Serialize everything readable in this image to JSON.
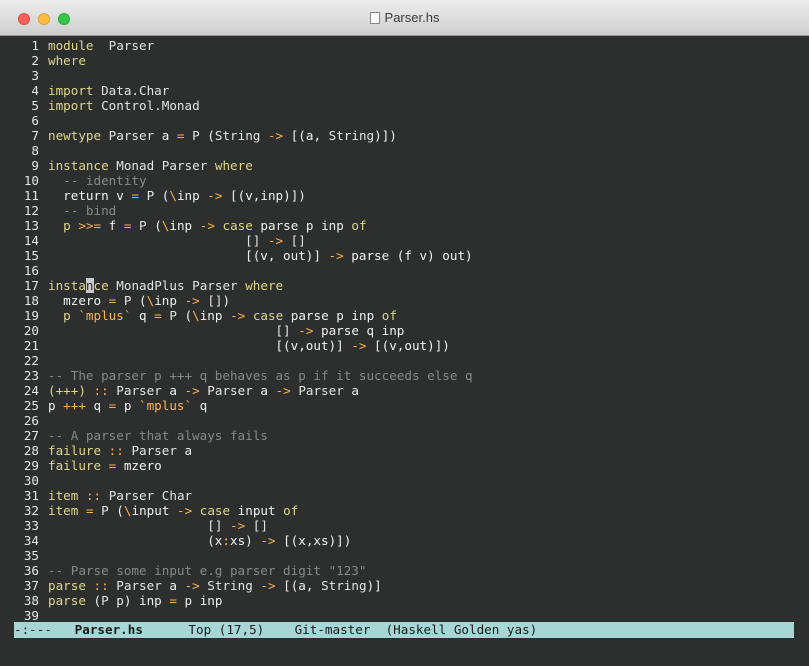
{
  "window": {
    "title": "Parser.hs"
  },
  "modeline": {
    "status": "-:---",
    "buffer": "Parser.hs",
    "position": "Top (17,5)",
    "vcs": "Git-master",
    "modes": "(Haskell Golden yas)"
  },
  "lines": [
    {
      "n": "1",
      "seg": [
        [
          "kw",
          "module"
        ],
        [
          "",
          "  "
        ],
        [
          "ty",
          "Parser"
        ]
      ]
    },
    {
      "n": "2",
      "seg": [
        [
          "kw",
          "where"
        ]
      ]
    },
    {
      "n": "3",
      "seg": []
    },
    {
      "n": "4",
      "seg": [
        [
          "kw",
          "import"
        ],
        [
          "",
          " "
        ],
        [
          "ty",
          "Data.Char"
        ]
      ]
    },
    {
      "n": "5",
      "seg": [
        [
          "kw",
          "import"
        ],
        [
          "",
          " "
        ],
        [
          "ty",
          "Control.Monad"
        ]
      ]
    },
    {
      "n": "6",
      "seg": []
    },
    {
      "n": "7",
      "seg": [
        [
          "kw",
          "newtype"
        ],
        [
          "",
          " "
        ],
        [
          "ty",
          "Parser"
        ],
        [
          "",
          " a "
        ],
        [
          "op",
          "="
        ],
        [
          "",
          " "
        ],
        [
          "ty",
          "P"
        ],
        [
          "",
          " ("
        ],
        [
          "ty",
          "String"
        ],
        [
          "",
          " "
        ],
        [
          "op",
          "->"
        ],
        [
          "",
          " [(a, "
        ],
        [
          "ty",
          "String"
        ],
        [
          "",
          ")])"
        ]
      ]
    },
    {
      "n": "8",
      "seg": []
    },
    {
      "n": "9",
      "seg": [
        [
          "kw",
          "instance"
        ],
        [
          "",
          " "
        ],
        [
          "ty",
          "Monad"
        ],
        [
          "",
          " "
        ],
        [
          "ty",
          "Parser"
        ],
        [
          "",
          " "
        ],
        [
          "kw",
          "where"
        ]
      ]
    },
    {
      "n": "10",
      "seg": [
        [
          "",
          "  "
        ],
        [
          "cm",
          "-- identity"
        ]
      ]
    },
    {
      "n": "11",
      "seg": [
        [
          "",
          "  return v "
        ],
        [
          "op",
          "="
        ],
        [
          "",
          " "
        ],
        [
          "ty",
          "P"
        ],
        [
          "",
          " ("
        ],
        [
          "op",
          "\\"
        ],
        [
          "",
          "inp "
        ],
        [
          "op",
          "->"
        ],
        [
          "",
          " [(v,inp)])"
        ]
      ]
    },
    {
      "n": "12",
      "seg": [
        [
          "",
          "  "
        ],
        [
          "cm",
          "-- bind"
        ]
      ]
    },
    {
      "n": "13",
      "seg": [
        [
          "kw",
          "  p"
        ],
        [
          "",
          " "
        ],
        [
          "op",
          ">>="
        ],
        [
          "",
          " f "
        ],
        [
          "op",
          "="
        ],
        [
          "",
          " "
        ],
        [
          "ty",
          "P"
        ],
        [
          "",
          " ("
        ],
        [
          "op",
          "\\"
        ],
        [
          "",
          "inp "
        ],
        [
          "op",
          "->"
        ],
        [
          "",
          " "
        ],
        [
          "kw",
          "case"
        ],
        [
          "",
          " parse p inp "
        ],
        [
          "kw",
          "of"
        ]
      ]
    },
    {
      "n": "14",
      "seg": [
        [
          "",
          "                          "
        ],
        [
          "ty",
          "[]"
        ],
        [
          "",
          " "
        ],
        [
          "op",
          "->"
        ],
        [
          "",
          " "
        ],
        [
          "ty",
          "[]"
        ]
      ]
    },
    {
      "n": "15",
      "seg": [
        [
          "",
          "                          [(v, out)] "
        ],
        [
          "op",
          "->"
        ],
        [
          "",
          " parse (f v) out)"
        ]
      ]
    },
    {
      "n": "16",
      "seg": []
    },
    {
      "n": "17",
      "seg": [
        [
          "kw",
          "insta"
        ],
        [
          "cursor",
          "n"
        ],
        [
          "kw",
          "ce"
        ],
        [
          "",
          " "
        ],
        [
          "ty",
          "MonadPlus"
        ],
        [
          "",
          " "
        ],
        [
          "ty",
          "Parser"
        ],
        [
          "",
          " "
        ],
        [
          "kw",
          "where"
        ]
      ]
    },
    {
      "n": "18",
      "seg": [
        [
          "",
          "  mzero "
        ],
        [
          "op",
          "="
        ],
        [
          "",
          " "
        ],
        [
          "ty",
          "P"
        ],
        [
          "",
          " ("
        ],
        [
          "op",
          "\\"
        ],
        [
          "",
          "inp "
        ],
        [
          "op",
          "->"
        ],
        [
          "",
          " "
        ],
        [
          "ty",
          "[]"
        ],
        [
          "",
          ")"
        ]
      ]
    },
    {
      "n": "19",
      "seg": [
        [
          "kw",
          "  p"
        ],
        [
          "",
          " "
        ],
        [
          "op",
          "`mplus`"
        ],
        [
          "",
          " q "
        ],
        [
          "op",
          "="
        ],
        [
          "",
          " "
        ],
        [
          "ty",
          "P"
        ],
        [
          "",
          " ("
        ],
        [
          "op",
          "\\"
        ],
        [
          "",
          "inp "
        ],
        [
          "op",
          "->"
        ],
        [
          "",
          " "
        ],
        [
          "kw",
          "case"
        ],
        [
          "",
          " parse p inp "
        ],
        [
          "kw",
          "of"
        ]
      ]
    },
    {
      "n": "20",
      "seg": [
        [
          "",
          "                              "
        ],
        [
          "ty",
          "[]"
        ],
        [
          "",
          " "
        ],
        [
          "op",
          "->"
        ],
        [
          "",
          " parse q inp"
        ]
      ]
    },
    {
      "n": "21",
      "seg": [
        [
          "",
          "                              [(v,out)] "
        ],
        [
          "op",
          "->"
        ],
        [
          "",
          " [(v,out)])"
        ]
      ]
    },
    {
      "n": "22",
      "seg": []
    },
    {
      "n": "23",
      "seg": [
        [
          "cm",
          "-- The parser p +++ q behaves as p if it succeeds else q"
        ]
      ]
    },
    {
      "n": "24",
      "seg": [
        [
          "kw",
          "(+++)"
        ],
        [
          "",
          " "
        ],
        [
          "op",
          "::"
        ],
        [
          "",
          " "
        ],
        [
          "ty",
          "Parser"
        ],
        [
          "",
          " a "
        ],
        [
          "op",
          "->"
        ],
        [
          "",
          " "
        ],
        [
          "ty",
          "Parser"
        ],
        [
          "",
          " a "
        ],
        [
          "op",
          "->"
        ],
        [
          "",
          " "
        ],
        [
          "ty",
          "Parser"
        ],
        [
          "",
          " a"
        ]
      ]
    },
    {
      "n": "25",
      "seg": [
        [
          "",
          "p "
        ],
        [
          "op",
          "+++"
        ],
        [
          "",
          " q "
        ],
        [
          "op",
          "="
        ],
        [
          "",
          " p "
        ],
        [
          "op",
          "`mplus`"
        ],
        [
          "",
          " q"
        ]
      ]
    },
    {
      "n": "26",
      "seg": []
    },
    {
      "n": "27",
      "seg": [
        [
          "cm",
          "-- A parser that always fails"
        ]
      ]
    },
    {
      "n": "28",
      "seg": [
        [
          "kw",
          "failure"
        ],
        [
          "",
          " "
        ],
        [
          "op",
          "::"
        ],
        [
          "",
          " "
        ],
        [
          "ty",
          "Parser"
        ],
        [
          "",
          " a"
        ]
      ]
    },
    {
      "n": "29",
      "seg": [
        [
          "kw",
          "failure"
        ],
        [
          "",
          " "
        ],
        [
          "op",
          "="
        ],
        [
          "",
          " mzero"
        ]
      ]
    },
    {
      "n": "30",
      "seg": []
    },
    {
      "n": "31",
      "seg": [
        [
          "kw",
          "item"
        ],
        [
          "",
          " "
        ],
        [
          "op",
          "::"
        ],
        [
          "",
          " "
        ],
        [
          "ty",
          "Parser"
        ],
        [
          "",
          " "
        ],
        [
          "ty",
          "Char"
        ]
      ]
    },
    {
      "n": "32",
      "seg": [
        [
          "kw",
          "item"
        ],
        [
          "",
          " "
        ],
        [
          "op",
          "="
        ],
        [
          "",
          " "
        ],
        [
          "ty",
          "P"
        ],
        [
          "",
          " ("
        ],
        [
          "op",
          "\\"
        ],
        [
          "",
          "input "
        ],
        [
          "op",
          "->"
        ],
        [
          "",
          " "
        ],
        [
          "kw",
          "case"
        ],
        [
          "",
          " input "
        ],
        [
          "kw",
          "of"
        ]
      ]
    },
    {
      "n": "33",
      "seg": [
        [
          "",
          "                     "
        ],
        [
          "ty",
          "[]"
        ],
        [
          "",
          " "
        ],
        [
          "op",
          "->"
        ],
        [
          "",
          " "
        ],
        [
          "ty",
          "[]"
        ]
      ]
    },
    {
      "n": "34",
      "seg": [
        [
          "",
          "                     (x"
        ],
        [
          "op",
          ":"
        ],
        [
          "",
          "xs) "
        ],
        [
          "op",
          "->"
        ],
        [
          "",
          " [(x,xs)])"
        ]
      ]
    },
    {
      "n": "35",
      "seg": []
    },
    {
      "n": "36",
      "seg": [
        [
          "cm",
          "-- Parse some input e.g parser digit \"123\""
        ]
      ]
    },
    {
      "n": "37",
      "seg": [
        [
          "kw",
          "parse"
        ],
        [
          "",
          " "
        ],
        [
          "op",
          "::"
        ],
        [
          "",
          " "
        ],
        [
          "ty",
          "Parser"
        ],
        [
          "",
          " a "
        ],
        [
          "op",
          "->"
        ],
        [
          "",
          " "
        ],
        [
          "ty",
          "String"
        ],
        [
          "",
          " "
        ],
        [
          "op",
          "->"
        ],
        [
          "",
          " [(a, "
        ],
        [
          "ty",
          "String"
        ],
        [
          "",
          ")]"
        ]
      ]
    },
    {
      "n": "38",
      "seg": [
        [
          "kw",
          "parse"
        ],
        [
          "",
          " ("
        ],
        [
          "ty",
          "P"
        ],
        [
          "",
          " p) inp "
        ],
        [
          "op",
          "="
        ],
        [
          "",
          " p inp"
        ]
      ]
    },
    {
      "n": "39",
      "seg": []
    }
  ]
}
